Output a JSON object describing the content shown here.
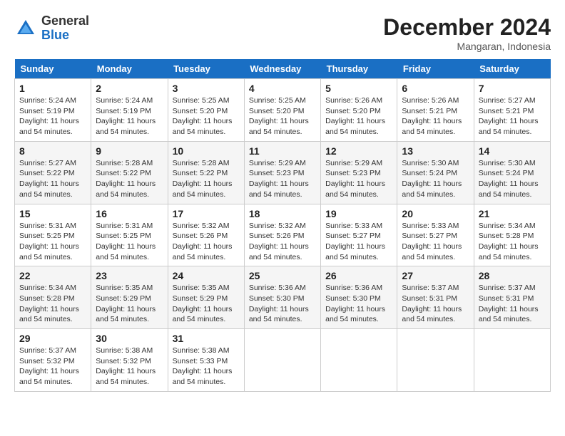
{
  "header": {
    "logo_general": "General",
    "logo_blue": "Blue",
    "title": "December 2024",
    "location": "Mangaran, Indonesia"
  },
  "weekdays": [
    "Sunday",
    "Monday",
    "Tuesday",
    "Wednesday",
    "Thursday",
    "Friday",
    "Saturday"
  ],
  "weeks": [
    [
      {
        "day": "1",
        "sunrise": "5:24 AM",
        "sunset": "5:19 PM",
        "daylight": "11 hours and 54 minutes."
      },
      {
        "day": "2",
        "sunrise": "5:24 AM",
        "sunset": "5:19 PM",
        "daylight": "11 hours and 54 minutes."
      },
      {
        "day": "3",
        "sunrise": "5:25 AM",
        "sunset": "5:20 PM",
        "daylight": "11 hours and 54 minutes."
      },
      {
        "day": "4",
        "sunrise": "5:25 AM",
        "sunset": "5:20 PM",
        "daylight": "11 hours and 54 minutes."
      },
      {
        "day": "5",
        "sunrise": "5:26 AM",
        "sunset": "5:20 PM",
        "daylight": "11 hours and 54 minutes."
      },
      {
        "day": "6",
        "sunrise": "5:26 AM",
        "sunset": "5:21 PM",
        "daylight": "11 hours and 54 minutes."
      },
      {
        "day": "7",
        "sunrise": "5:27 AM",
        "sunset": "5:21 PM",
        "daylight": "11 hours and 54 minutes."
      }
    ],
    [
      {
        "day": "8",
        "sunrise": "5:27 AM",
        "sunset": "5:22 PM",
        "daylight": "11 hours and 54 minutes."
      },
      {
        "day": "9",
        "sunrise": "5:28 AM",
        "sunset": "5:22 PM",
        "daylight": "11 hours and 54 minutes."
      },
      {
        "day": "10",
        "sunrise": "5:28 AM",
        "sunset": "5:22 PM",
        "daylight": "11 hours and 54 minutes."
      },
      {
        "day": "11",
        "sunrise": "5:29 AM",
        "sunset": "5:23 PM",
        "daylight": "11 hours and 54 minutes."
      },
      {
        "day": "12",
        "sunrise": "5:29 AM",
        "sunset": "5:23 PM",
        "daylight": "11 hours and 54 minutes."
      },
      {
        "day": "13",
        "sunrise": "5:30 AM",
        "sunset": "5:24 PM",
        "daylight": "11 hours and 54 minutes."
      },
      {
        "day": "14",
        "sunrise": "5:30 AM",
        "sunset": "5:24 PM",
        "daylight": "11 hours and 54 minutes."
      }
    ],
    [
      {
        "day": "15",
        "sunrise": "5:31 AM",
        "sunset": "5:25 PM",
        "daylight": "11 hours and 54 minutes."
      },
      {
        "day": "16",
        "sunrise": "5:31 AM",
        "sunset": "5:25 PM",
        "daylight": "11 hours and 54 minutes."
      },
      {
        "day": "17",
        "sunrise": "5:32 AM",
        "sunset": "5:26 PM",
        "daylight": "11 hours and 54 minutes."
      },
      {
        "day": "18",
        "sunrise": "5:32 AM",
        "sunset": "5:26 PM",
        "daylight": "11 hours and 54 minutes."
      },
      {
        "day": "19",
        "sunrise": "5:33 AM",
        "sunset": "5:27 PM",
        "daylight": "11 hours and 54 minutes."
      },
      {
        "day": "20",
        "sunrise": "5:33 AM",
        "sunset": "5:27 PM",
        "daylight": "11 hours and 54 minutes."
      },
      {
        "day": "21",
        "sunrise": "5:34 AM",
        "sunset": "5:28 PM",
        "daylight": "11 hours and 54 minutes."
      }
    ],
    [
      {
        "day": "22",
        "sunrise": "5:34 AM",
        "sunset": "5:28 PM",
        "daylight": "11 hours and 54 minutes."
      },
      {
        "day": "23",
        "sunrise": "5:35 AM",
        "sunset": "5:29 PM",
        "daylight": "11 hours and 54 minutes."
      },
      {
        "day": "24",
        "sunrise": "5:35 AM",
        "sunset": "5:29 PM",
        "daylight": "11 hours and 54 minutes."
      },
      {
        "day": "25",
        "sunrise": "5:36 AM",
        "sunset": "5:30 PM",
        "daylight": "11 hours and 54 minutes."
      },
      {
        "day": "26",
        "sunrise": "5:36 AM",
        "sunset": "5:30 PM",
        "daylight": "11 hours and 54 minutes."
      },
      {
        "day": "27",
        "sunrise": "5:37 AM",
        "sunset": "5:31 PM",
        "daylight": "11 hours and 54 minutes."
      },
      {
        "day": "28",
        "sunrise": "5:37 AM",
        "sunset": "5:31 PM",
        "daylight": "11 hours and 54 minutes."
      }
    ],
    [
      {
        "day": "29",
        "sunrise": "5:37 AM",
        "sunset": "5:32 PM",
        "daylight": "11 hours and 54 minutes."
      },
      {
        "day": "30",
        "sunrise": "5:38 AM",
        "sunset": "5:32 PM",
        "daylight": "11 hours and 54 minutes."
      },
      {
        "day": "31",
        "sunrise": "5:38 AM",
        "sunset": "5:33 PM",
        "daylight": "11 hours and 54 minutes."
      },
      null,
      null,
      null,
      null
    ]
  ]
}
